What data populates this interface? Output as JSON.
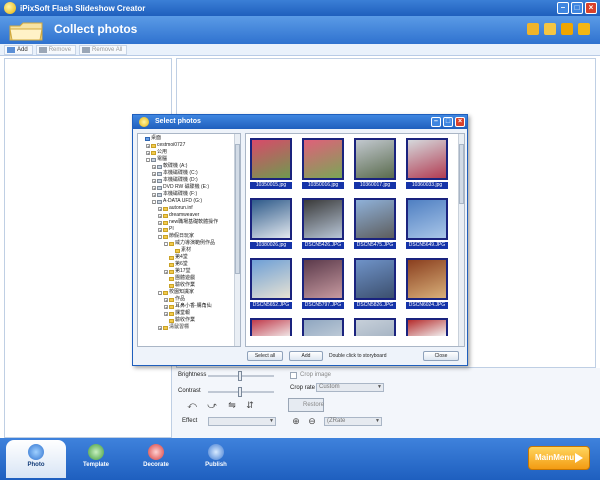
{
  "window": {
    "title": "iPixSoft Flash Slideshow Creator"
  },
  "header": {
    "title": "Collect photos"
  },
  "toolbar": {
    "add": "Add",
    "remove": "Remove",
    "remove_all": "Remove All"
  },
  "controls": {
    "brightness": "Brightness",
    "contrast": "Contrast",
    "effect": "Effect",
    "crop_image": "Crop image",
    "crop_rate": "Crop rate",
    "crop_rate_value": "Custom",
    "restore": "Restore",
    "fit_value": "(ZRate"
  },
  "bottom_tabs": [
    "Photo",
    "Template",
    "Decorate",
    "Publish"
  ],
  "main_menu": "MainMenu",
  "dialog": {
    "title": "Select photos",
    "tree": [
      {
        "label": "桌面",
        "indent": 0,
        "type": "desk",
        "exp": ""
      },
      {
        "label": "cestmoi0727",
        "indent": 1,
        "type": "folder",
        "exp": "+"
      },
      {
        "label": "公用",
        "indent": 1,
        "type": "folder",
        "exp": "+"
      },
      {
        "label": "電腦",
        "indent": 1,
        "type": "drive",
        "exp": "-"
      },
      {
        "label": "軟碟機 (A:)",
        "indent": 2,
        "type": "drive",
        "exp": "+"
      },
      {
        "label": "本機磁碟機 (C:)",
        "indent": 2,
        "type": "drive",
        "exp": "+"
      },
      {
        "label": "本機磁碟機 (D:)",
        "indent": 2,
        "type": "drive",
        "exp": "+"
      },
      {
        "label": "DVD RW 磁碟機 (E:)",
        "indent": 2,
        "type": "drive",
        "exp": "+"
      },
      {
        "label": "本機磁碟機 (F:)",
        "indent": 2,
        "type": "drive",
        "exp": "+"
      },
      {
        "label": "A-DATA UFD (G:)",
        "indent": 2,
        "type": "drive",
        "exp": "-"
      },
      {
        "label": "autorun.inf",
        "indent": 3,
        "type": "folder",
        "exp": "+"
      },
      {
        "label": "dreamweaver",
        "indent": 3,
        "type": "folder",
        "exp": "+"
      },
      {
        "label": "new職場基礎軟體操作",
        "indent": 3,
        "type": "folder",
        "exp": "+"
      },
      {
        "label": "PI",
        "indent": 3,
        "type": "folder",
        "exp": "+"
      },
      {
        "label": "節假日玩家",
        "indent": 3,
        "type": "folder",
        "exp": "-"
      },
      {
        "label": "威力導演範例作品",
        "indent": 4,
        "type": "folder",
        "exp": "-"
      },
      {
        "label": "素材",
        "indent": 5,
        "type": "folder",
        "exp": ""
      },
      {
        "label": "第4堂",
        "indent": 4,
        "type": "folder",
        "exp": ""
      },
      {
        "label": "第6堂",
        "indent": 4,
        "type": "folder",
        "exp": ""
      },
      {
        "label": "第17堂",
        "indent": 4,
        "type": "folder",
        "exp": "+"
      },
      {
        "label": "團體遊戲",
        "indent": 4,
        "type": "folder",
        "exp": ""
      },
      {
        "label": "驗收作業",
        "indent": 4,
        "type": "folder",
        "exp": ""
      },
      {
        "label": "校園知識家",
        "indent": 3,
        "type": "folder",
        "exp": "-"
      },
      {
        "label": "作品",
        "indent": 4,
        "type": "folder",
        "exp": "+"
      },
      {
        "label": "耳鼻小香-購角仙",
        "indent": 4,
        "type": "folder",
        "exp": "+"
      },
      {
        "label": "課堂報",
        "indent": 4,
        "type": "folder",
        "exp": "+"
      },
      {
        "label": "驗收作業",
        "indent": 4,
        "type": "folder",
        "exp": ""
      },
      {
        "label": "清鼠習標",
        "indent": 3,
        "type": "folder",
        "exp": "+"
      }
    ],
    "photos": [
      {
        "name": "10350015.jpg",
        "c1": "#d94a6a",
        "c2": "#6f9a4f"
      },
      {
        "name": "10350016.jpg",
        "c1": "#e0607a",
        "c2": "#7aa656"
      },
      {
        "name": "10360017.jpg",
        "c1": "#c2c8cf",
        "c2": "#5a6b4d"
      },
      {
        "name": "10360033.jpg",
        "c1": "#d5d9dc",
        "c2": "#b23b52"
      },
      {
        "name": "10380026.jpg",
        "c1": "#2e5a8a",
        "c2": "#e2e8ee"
      },
      {
        "name": "DSCN5426.JPG",
        "c1": "#3a3a3a",
        "c2": "#b9c7d8"
      },
      {
        "name": "DSCN5475.JPG",
        "c1": "#8fb1d9",
        "c2": "#5d5d5d"
      },
      {
        "name": "DSCN5649.JPG",
        "c1": "#4f7fc2",
        "c2": "#a9c6e8"
      },
      {
        "name": "DSCN5652.JPG",
        "c1": "#6e9fd6",
        "c2": "#e7e2d3"
      },
      {
        "name": "DSCN5797.JPG",
        "c1": "#5b3a4b",
        "c2": "#c79aa0"
      },
      {
        "name": "DSCN5826.JPG",
        "c1": "#6f93c8",
        "c2": "#3c4f6e"
      },
      {
        "name": "DSCN6024.JPG",
        "c1": "#8a3f1f",
        "c2": "#d9b07a"
      },
      {
        "name": "",
        "c1": "#c03a4b",
        "c2": "#f0e4e4"
      },
      {
        "name": "",
        "c1": "#8fa6c0",
        "c2": "#bcc9d6"
      },
      {
        "name": "",
        "c1": "#c7d0da",
        "c2": "#a7b5c4"
      },
      {
        "name": "",
        "c1": "#b52b2b",
        "c2": "#f2f2f2"
      }
    ],
    "select_all": "Select all",
    "add": "Add",
    "hint": "Double click to storyboard",
    "close": "Close"
  }
}
